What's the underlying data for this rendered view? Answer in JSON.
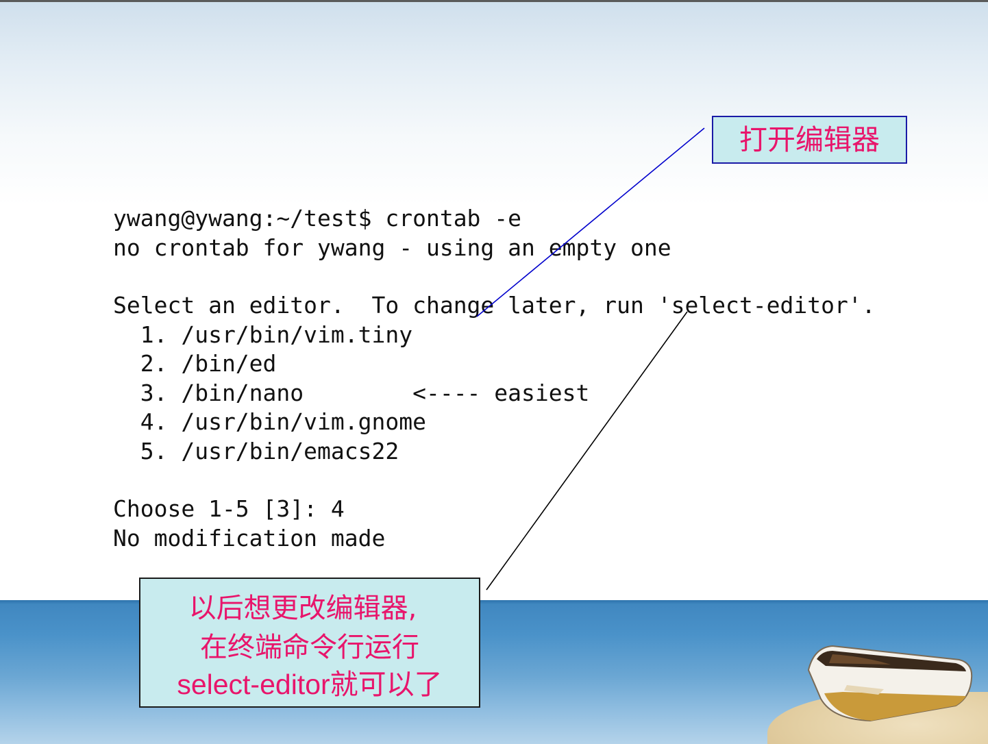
{
  "callouts": {
    "open_editor": "打开编辑器",
    "change_editor_line1": "以后想更改编辑器,",
    "change_editor_line2": "在终端命令行运行",
    "change_editor_line3": "select-editor就可以了"
  },
  "terminal": {
    "lines": [
      "ywang@ywang:~/test$ crontab -e",
      "no crontab for ywang - using an empty one",
      "",
      "Select an editor.  To change later, run 'select-editor'.",
      "  1. /usr/bin/vim.tiny",
      "  2. /bin/ed",
      "  3. /bin/nano        <---- easiest",
      "  4. /usr/bin/vim.gnome",
      "  5. /usr/bin/emacs22",
      "",
      "Choose 1-5 [3]: 4",
      "No modification made"
    ]
  },
  "colors": {
    "callout_text": "#e8156b",
    "callout_fill": "#c8ebee",
    "top_callout_border": "#1a1aa6",
    "bottom_callout_border": "#1a1a1a",
    "top_connector": "#0000cc",
    "bottom_connector": "#000000"
  },
  "decoration": {
    "background": "sea-and-beach-with-boat"
  }
}
